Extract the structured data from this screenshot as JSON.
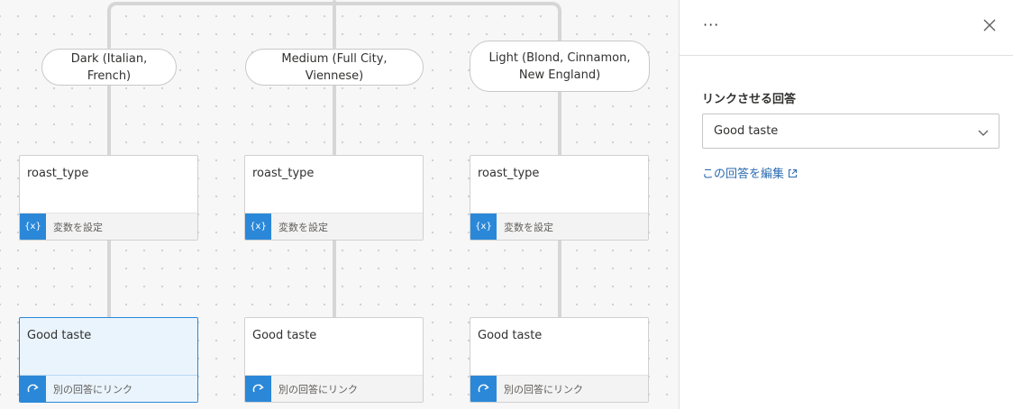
{
  "canvas": {
    "choices": [
      {
        "label": "Dark (Italian, French)"
      },
      {
        "label": "Medium (Full City, Viennese)"
      },
      {
        "label": "Light (Blond, Cinnamon,\nNew England)"
      }
    ],
    "variable_nodes": [
      {
        "title": "roast_type",
        "action": "変数を設定",
        "icon": "variable-icon"
      },
      {
        "title": "roast_type",
        "action": "変数を設定",
        "icon": "variable-icon"
      },
      {
        "title": "roast_type",
        "action": "変数を設定",
        "icon": "variable-icon"
      }
    ],
    "link_nodes": [
      {
        "title": "Good taste",
        "action": "別の回答にリンク",
        "icon": "link-redirect-icon",
        "selected": true
      },
      {
        "title": "Good taste",
        "action": "別の回答にリンク",
        "icon": "link-redirect-icon",
        "selected": false
      },
      {
        "title": "Good taste",
        "action": "別の回答にリンク",
        "icon": "link-redirect-icon",
        "selected": false
      }
    ]
  },
  "panel": {
    "more_label": "···",
    "field_label": "リンクさせる回答",
    "selected_answer": "Good taste",
    "edit_link": "この回答を編集"
  },
  "colors": {
    "accent": "#2b88d8",
    "link": "#2b6cb0",
    "selected_fill": "#eaf4fc"
  }
}
